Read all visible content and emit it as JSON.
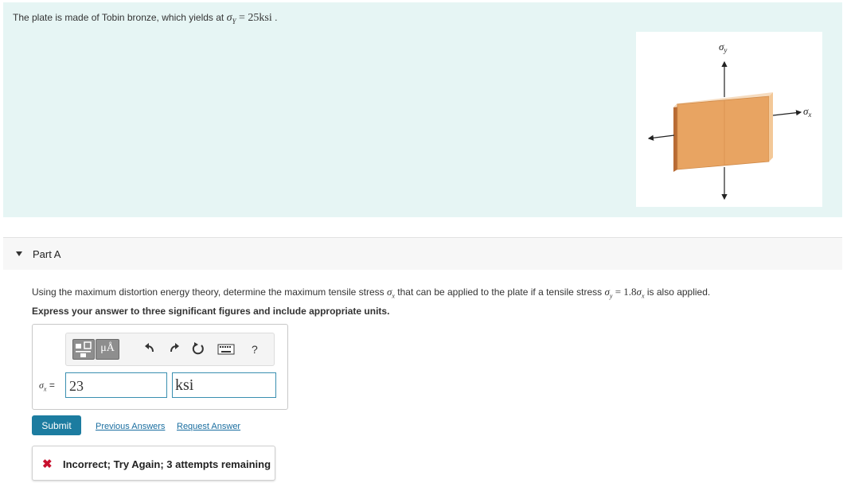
{
  "problem": {
    "text_prefix": "The plate is made of Tobin bronze, which yields at",
    "sigma_symbol": "σ",
    "yield_subscript": "Y",
    "yield_value": " = 25ksi",
    "text_suffix": " ."
  },
  "figure": {
    "label_sigma_y": "σ",
    "label_sigma_y_sub": "y",
    "label_sigma_x": "σ",
    "label_sigma_x_sub": "x",
    "plate_color": "#e8a462"
  },
  "part": {
    "title": "Part A",
    "question_prefix": "Using the maximum distortion energy theory, determine the maximum tensile stress",
    "question_var_x": "σ",
    "question_var_x_sub": "x",
    "question_middle": " that can be applied to the plate if a tensile stress ",
    "question_var_y": "σ",
    "question_var_y_sub": "y",
    "question_relation": " = 1.8",
    "question_var_x2": "σ",
    "question_var_x2_sub": "x",
    "question_suffix": " is also applied.",
    "instruction": "Express your answer to three significant figures and include appropriate units."
  },
  "answer": {
    "var_symbol": "σ",
    "var_sub": "x",
    "equals": " =",
    "value": "23",
    "unit": "ksi",
    "toolbar": {
      "templates_icon": "templates-icon",
      "units_button_label": "μÅ",
      "undo_icon": "undo-icon",
      "redo_icon": "redo-icon",
      "reset_icon": "reset-icon",
      "keyboard_icon": "keyboard-icon",
      "help_label": "?"
    }
  },
  "actions": {
    "submit": "Submit",
    "previous_answers": "Previous Answers",
    "request_answer": "Request Answer"
  },
  "feedback": {
    "icon": "✖",
    "text": "Incorrect; Try Again; 3 attempts remaining"
  },
  "colors": {
    "panel_bg": "#e6f5f4",
    "accent": "#1c7ca0",
    "error": "#c8102e",
    "input_border": "#3a8fb0"
  }
}
